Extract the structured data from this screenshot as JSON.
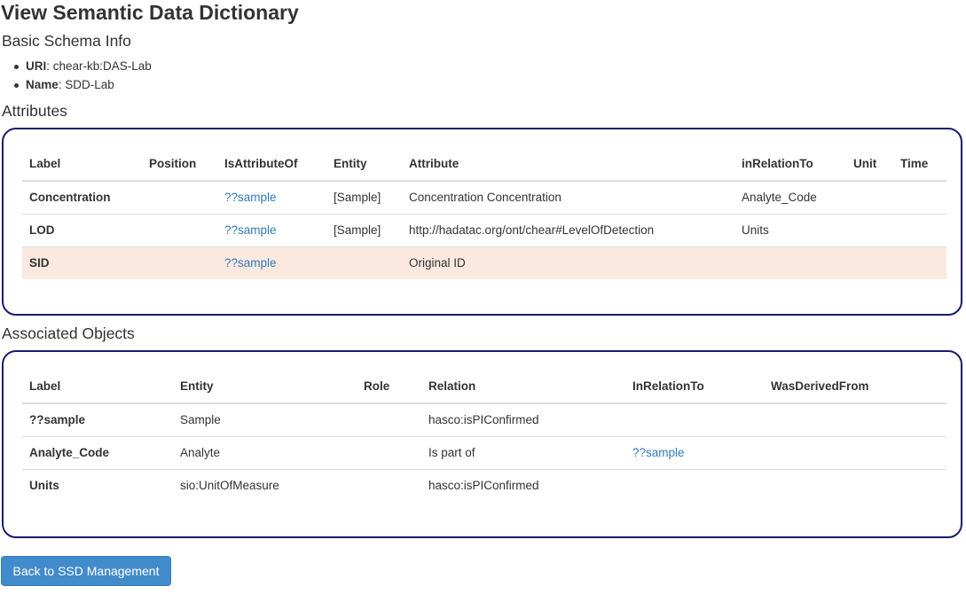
{
  "page": {
    "title": "View Semantic Data Dictionary"
  },
  "basic_info": {
    "heading": "Basic Schema Info",
    "items": [
      {
        "key": "URI",
        "value": ": chear-kb:DAS-Lab"
      },
      {
        "key": "Name",
        "value": ": SDD-Lab"
      }
    ]
  },
  "attributes": {
    "heading": "Attributes",
    "columns": [
      "Label",
      "Position",
      "IsAttributeOf",
      "Entity",
      "Attribute",
      "inRelationTo",
      "Unit",
      "Time"
    ],
    "rows": [
      {
        "label": "Concentration",
        "position": "",
        "is_attribute_of": "??sample",
        "entity": "[Sample]",
        "attribute": "Concentration Concentration",
        "in_relation_to": "Analyte_Code",
        "unit": "",
        "time": "",
        "highlight": false
      },
      {
        "label": "LOD",
        "position": "",
        "is_attribute_of": "??sample",
        "entity": "[Sample]",
        "attribute": "http://hadatac.org/ont/chear#LevelOfDetection",
        "in_relation_to": "Units",
        "unit": "",
        "time": "",
        "highlight": false
      },
      {
        "label": "SID",
        "position": "",
        "is_attribute_of": "??sample",
        "entity": "",
        "attribute": "Original ID",
        "in_relation_to": "",
        "unit": "",
        "time": "",
        "highlight": true
      }
    ]
  },
  "objects": {
    "heading": "Associated Objects",
    "columns": [
      "Label",
      "Entity",
      "Role",
      "Relation",
      "InRelationTo",
      "WasDerivedFrom"
    ],
    "rows": [
      {
        "label": "??sample",
        "entity": "Sample",
        "role": "",
        "relation": "hasco:isPIConfirmed",
        "in_relation_to": "",
        "was_derived_from": ""
      },
      {
        "label": "Analyte_Code",
        "entity": "Analyte",
        "role": "",
        "relation": "Is part of",
        "in_relation_to": "??sample",
        "was_derived_from": ""
      },
      {
        "label": "Units",
        "entity": "sio:UnitOfMeasure",
        "role": "",
        "relation": "hasco:isPIConfirmed",
        "in_relation_to": "",
        "was_derived_from": ""
      }
    ]
  },
  "actions": {
    "back_label": "Back to SSD Management"
  },
  "colors": {
    "link": "#337ab7",
    "panel_border": "#1a1a6e",
    "highlight_row": "#fbe9e0",
    "button": "#428bca"
  }
}
